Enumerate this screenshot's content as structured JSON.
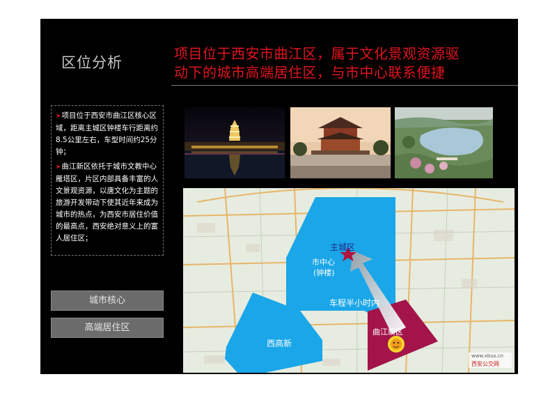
{
  "section_title": "区位分析",
  "headline": {
    "line1": "项目位于西安市曲江区，属于文化景观资源驱",
    "line2": "动下的城市高端居住区，与市中心联系便捷"
  },
  "description": [
    {
      "marker": "➤",
      "text": "项目位于西安市曲江区核心区域，距离主城区钟楼车行距离约8.5公里左右，车型时间约25分钟；"
    },
    {
      "marker": "➤",
      "text": "曲江新区依托于城市文教中心雁塔区，片区内部具备丰富的人文景观资源，以唐文化为主题的旅游开发带动下使其近年来成为城市的热点，为西安市居住价值的最高点，西安绝对意义上的富人居住区；"
    }
  ],
  "tags": [
    "城市核心",
    "高端居住区"
  ],
  "photos": [
    "big-wild-goose-pagoda-night-photo",
    "tang-style-pavilion-photo",
    "qujiang-lake-park-photo"
  ],
  "map": {
    "main_city_label": "主城区",
    "center_label_1": "市中心",
    "center_label_2": "(钟楼)",
    "drive_label": "车程半小时内",
    "qujiang_label": "曲江新区",
    "xigaoxin_label": "西高新",
    "watermark_url": "www.xbus.cn",
    "watermark_name": "西安公交网",
    "colors": {
      "main_city": "#1aa6e8",
      "qujiang": "#a3154a",
      "arrow": "#b8bec4"
    }
  }
}
